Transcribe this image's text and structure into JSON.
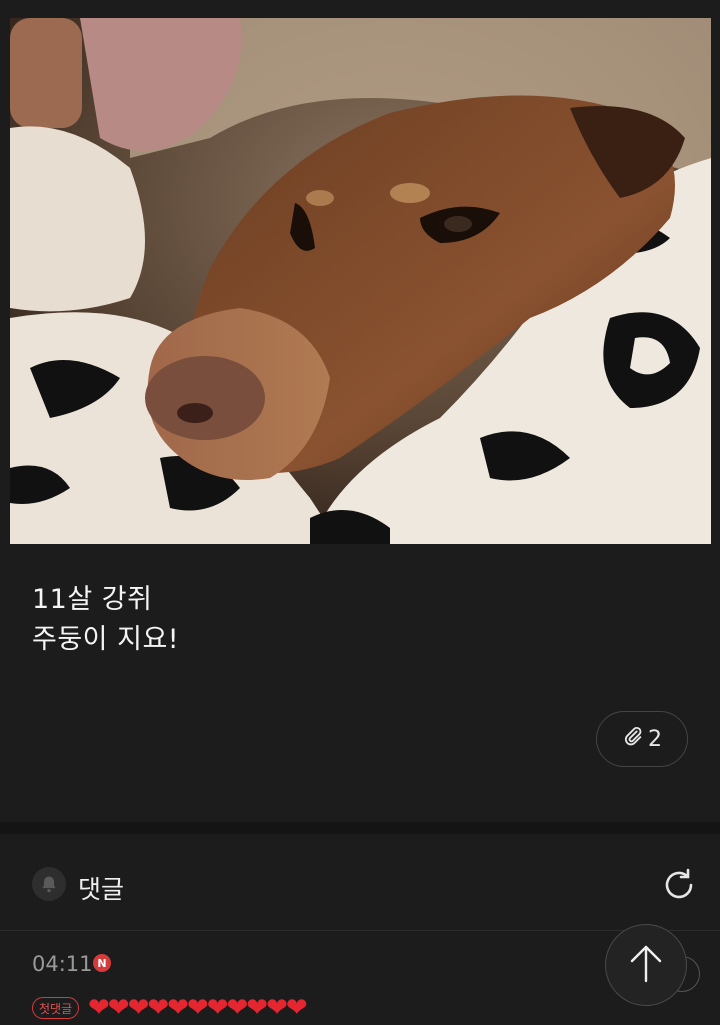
{
  "post": {
    "image_alt": "",
    "text_lines": [
      "11살 강쥐",
      "주둥이 지요!"
    ],
    "attachment_count": "2"
  },
  "comments": {
    "title": "댓글",
    "items": [
      {
        "time": "04:11",
        "new_badge": "N",
        "first_comment_badge": "첫댓글",
        "content": "❤❤❤❤❤❤❤❤❤❤❤"
      }
    ]
  },
  "colors": {
    "background": "#1c1c1d",
    "badge_red": "#d53b3b",
    "heart_red": "#e3262f"
  },
  "icons": [
    "paperclip-icon",
    "bell-icon",
    "refresh-icon",
    "arrow-up-icon",
    "more-icon"
  ]
}
